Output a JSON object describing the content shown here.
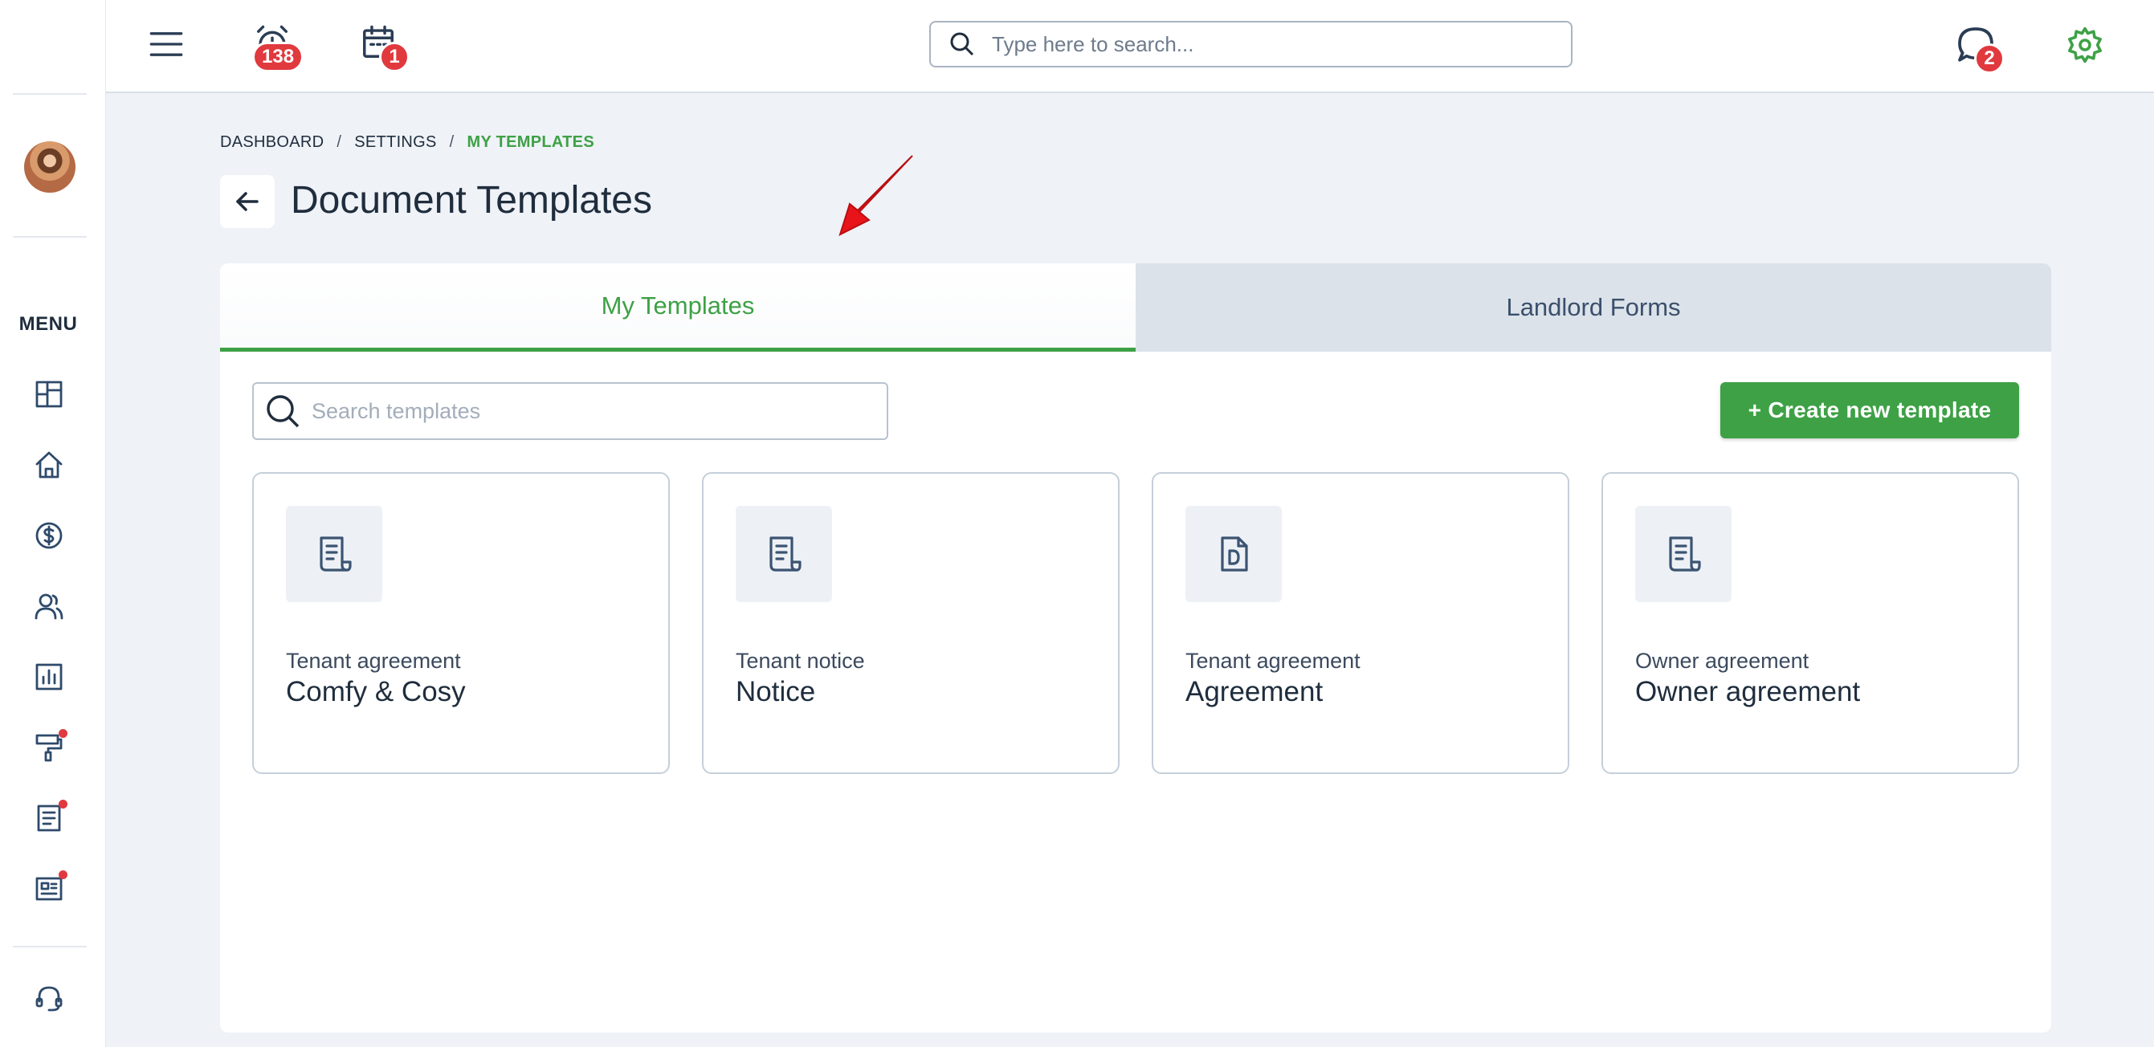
{
  "topbar": {
    "alarm_count": "138",
    "calendar_count": "1",
    "search_placeholder": "Type here to search...",
    "messages_count": "2"
  },
  "sidebar": {
    "menu_label": "MENU"
  },
  "breadcrumb": {
    "items": [
      "DASHBOARD",
      "SETTINGS",
      "MY TEMPLATES"
    ]
  },
  "page": {
    "title": "Document Templates"
  },
  "tabs": [
    {
      "label": "My Templates",
      "active": true
    },
    {
      "label": "Landlord Forms",
      "active": false
    }
  ],
  "templates_search": {
    "placeholder": "Search templates"
  },
  "create_button": {
    "label": "+ Create new template"
  },
  "cards": [
    {
      "kind": "Tenant agreement",
      "name": "Comfy & Cosy",
      "icon": "document-icon"
    },
    {
      "kind": "Tenant notice",
      "name": "Notice",
      "icon": "document-icon"
    },
    {
      "kind": "Tenant agreement",
      "name": "Agreement",
      "icon": "pdf-file-icon"
    },
    {
      "kind": "Owner agreement",
      "name": "Owner agreement",
      "icon": "document-icon"
    }
  ],
  "colors": {
    "accent_green": "#3ea146",
    "badge_red": "#e0393e",
    "annotation_red": "#e8141a"
  }
}
